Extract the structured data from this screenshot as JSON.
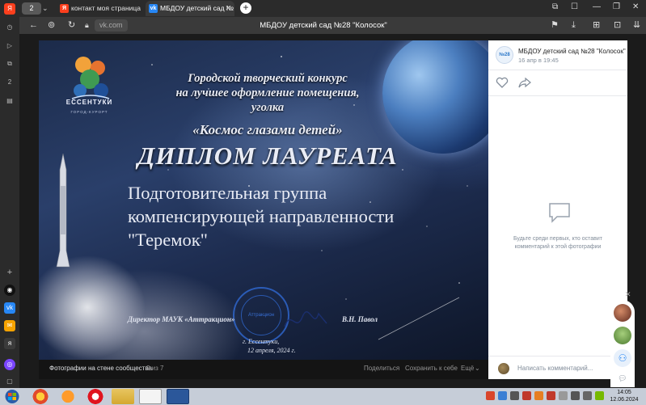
{
  "browser": {
    "tab_counter": "2",
    "tabs": [
      {
        "label": "контакт моя страница -- ",
        "icon": "yandex-icon"
      },
      {
        "label": "МБДОУ детский сад №",
        "icon": "vk-icon"
      }
    ],
    "address_host": "vk.com",
    "page_title": "МБДОУ детский сад №28 \"Колосок\""
  },
  "photo": {
    "logo_text": "ЕССЕНТУКИ",
    "logo_subtitle": "ГОРОД-КУРОРТ",
    "contest_lines": [
      "Городской творческий конкурс",
      "на лучшее оформление помещения,",
      "уголка"
    ],
    "contest_theme": "«Космос глазами детей»",
    "diploma_title": "ДИПЛОМ ЛАУРЕАТА",
    "recipient_lines": [
      "Подготовительная группа",
      "компенсирующей направленности",
      "\"Теремок\""
    ],
    "director_label": "Директор МАУК «Аттракцион»",
    "director_name": "В.Н. Павол",
    "place": "г. Ессентуки,",
    "date": "12 апреля, 2024 г.",
    "stamp_text": "Аттракцион"
  },
  "viewer_bar": {
    "caption": "Фотографии на стене сообщества",
    "counter": "2 из 7",
    "share": "Поделиться",
    "save": "Сохранить к себе",
    "more": "Ещё"
  },
  "info_panel": {
    "avatar_text": "№28",
    "community_name": "МБДОУ детский сад №28 \"Колосок\"",
    "date": "16 апр в 19:45",
    "more": "···",
    "empty_comments": "Будьте среди первых, кто оставит комментарий к этой фотографии",
    "comment_placeholder": "Написать комментарий..."
  },
  "taskbar": {
    "time": "14:05",
    "date": "12.06.2024"
  },
  "colors": {
    "vk_blue": "#2787f5",
    "yandex_red": "#fc3f1d",
    "space_dark": "#1c2b4a"
  }
}
